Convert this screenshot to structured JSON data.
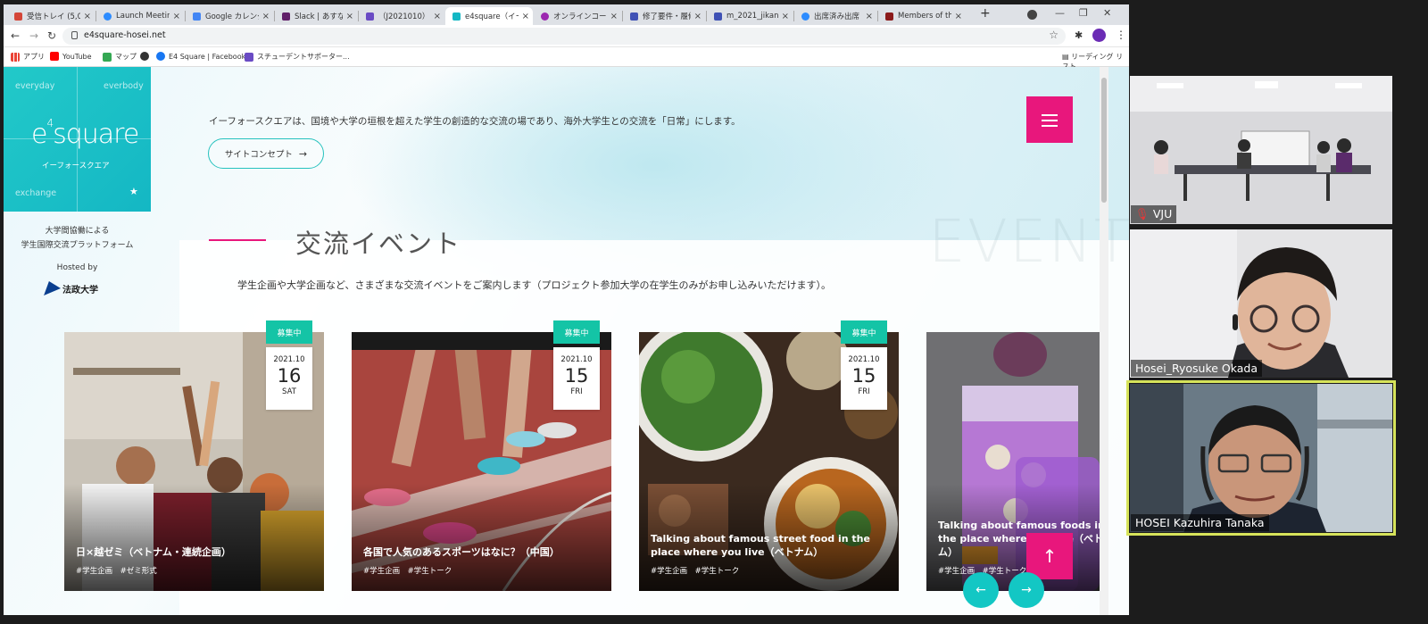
{
  "browser": {
    "tabs": [
      {
        "label": "受信トレイ (5,06",
        "color": "#d44638"
      },
      {
        "label": "Launch Meeting",
        "color": "#2d8cff"
      },
      {
        "label": "Google カレンダー",
        "color": "#4285f4"
      },
      {
        "label": "Slack | あすなる",
        "color": "#611f69"
      },
      {
        "label": "（J2021010）",
        "color": "#6a4bc4"
      },
      {
        "label": "e4square（イー",
        "color": "#14b7c4",
        "active": true
      },
      {
        "label": "オンラインコース",
        "color": "#9c27b0"
      },
      {
        "label": "修了要件・履修",
        "color": "#3f51b5"
      },
      {
        "label": "m_2021_jikanw",
        "color": "#3f51b5"
      },
      {
        "label": "出席済み出席",
        "color": "#2d8cff"
      },
      {
        "label": "Members of the",
        "color": "#8b1a1a"
      }
    ],
    "url": "e4square-hosei.net",
    "bookmarks": [
      {
        "label": "アプリ",
        "color": "#ea4335"
      },
      {
        "label": "YouTube",
        "color": "#ff0000"
      },
      {
        "label": "マップ",
        "color": "#34a853"
      },
      {
        "label": "",
        "color": "#333333"
      },
      {
        "label": "E4 Square | Facebook",
        "color": "#1877f2"
      },
      {
        "label": "スチューデントサポーター...",
        "color": "#6a4bc4"
      }
    ],
    "reading_list": "リーディング リスト"
  },
  "site": {
    "logo": {
      "everyday": "everyday",
      "everybody": "everbody",
      "exchange": "exchange",
      "main": "square",
      "superscript": "4",
      "prefix": "e",
      "kana": "イーフォースクエア"
    },
    "sidebar": {
      "tagline1": "大学間協働による",
      "tagline2": "学生国際交流プラットフォーム",
      "hosted_by": "Hosted by",
      "university": "法政大学"
    },
    "intro": "イーフォースクエアは、国境や大学の垣根を超えた学生の創造的な交流の場であり、海外大学生との交流を「日常」にします。",
    "concept_button": "サイトコンセプト",
    "event": {
      "title": "交流イベント",
      "title_en": "EVENT",
      "description": "学生企画や大学企画など、さまざまな交流イベントをご案内します（プロジェクト参加大学の在学生のみがお申し込みいただけます）。",
      "cards": [
        {
          "title": "日×越ゼミ（ベトナム・連続企画）",
          "tags": "#学生企画　#ゼミ形式",
          "badge": "募集中",
          "year_month": "2021.10",
          "day": "16",
          "weekday": "SAT"
        },
        {
          "title": "各国で人気のあるスポーツはなに？（中国）",
          "tags": "#学生企画　#学生トーク",
          "badge": "募集中",
          "year_month": "2021.10",
          "day": "15",
          "weekday": "FRI"
        },
        {
          "title": "Talking about famous street food in the place where you live（ベトナム）",
          "tags": "#学生企画　#学生トーク",
          "badge": "募集中",
          "year_month": "2021.10",
          "day": "15",
          "weekday": "FRI"
        },
        {
          "title": "Talking about famous foods in the place where you live（ベトナム）",
          "tags": "#学生企画　#学生トーク"
        }
      ]
    }
  },
  "meeting": {
    "participants": [
      {
        "name": "VJU",
        "muted": true
      },
      {
        "name": "Hosei_Ryosuke Okada",
        "muted": false
      },
      {
        "name": "HOSEI Kazuhira Tanaka",
        "muted": false,
        "speaking": true
      }
    ]
  },
  "colors": {
    "accent_pink": "#e8177c",
    "accent_teal": "#14c4a6",
    "logo_teal": "#14b7c4",
    "speaker_highlight": "#d6e35a"
  }
}
